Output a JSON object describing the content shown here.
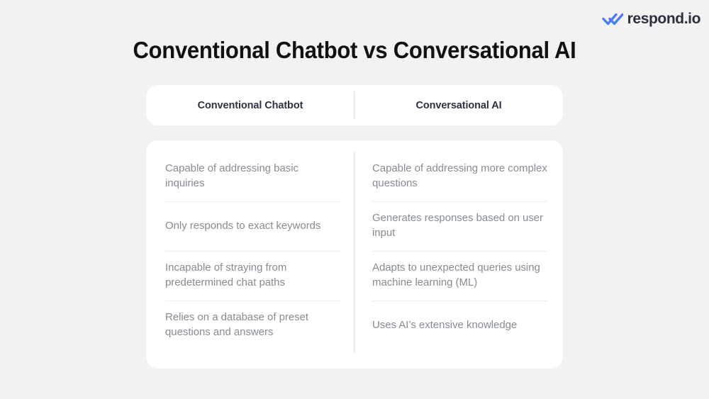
{
  "brand": {
    "name": "respond.io",
    "mark_icon": "double-check-icon",
    "mark_color": "#4b7bf5",
    "text_color": "#29313f"
  },
  "title": "Conventional Chatbot vs Conversational AI",
  "colors": {
    "background": "#f2f2f2",
    "card": "#ffffff",
    "title_text": "#111111",
    "header_text": "#2b3340",
    "body_text": "#868c93",
    "divider": "#dcdee1",
    "row_separator": "#ececec"
  },
  "table": {
    "columns": [
      {
        "header": "Conventional Chatbot",
        "rows": [
          "Capable of addressing basic inquiries",
          "Only responds to exact keywords",
          "Incapable of straying from predetermined chat paths",
          "Relies on a database of preset questions and answers"
        ]
      },
      {
        "header": "Conversational AI",
        "rows": [
          "Capable of addressing more complex questions",
          "Generates responses based on user input",
          "Adapts to unexpected queries using machine learning (ML)",
          "Uses AI’s extensive knowledge"
        ]
      }
    ]
  }
}
